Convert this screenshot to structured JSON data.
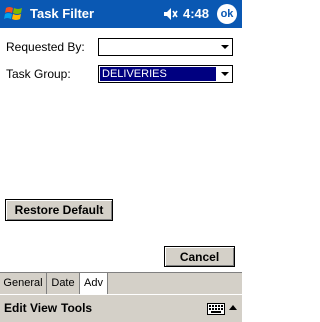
{
  "titlebar": {
    "title": "Task Filter",
    "time": "4:48",
    "ok_label": "ok"
  },
  "form": {
    "requested_by": {
      "label": "Requested By:",
      "value": ""
    },
    "task_group": {
      "label": "Task Group:",
      "value": "DELIVERIES"
    }
  },
  "buttons": {
    "restore_default": "Restore Default",
    "cancel": "Cancel"
  },
  "tabs": [
    {
      "label": "General",
      "active": false
    },
    {
      "label": "Date",
      "active": false
    },
    {
      "label": "Adv",
      "active": true
    }
  ],
  "menu": {
    "edit": "Edit",
    "view": "View",
    "tools": "Tools"
  },
  "colors": {
    "titlebar_bg": "#0a58b3",
    "selection_bg": "#000080",
    "chrome_bg": "#d4d0c8"
  }
}
